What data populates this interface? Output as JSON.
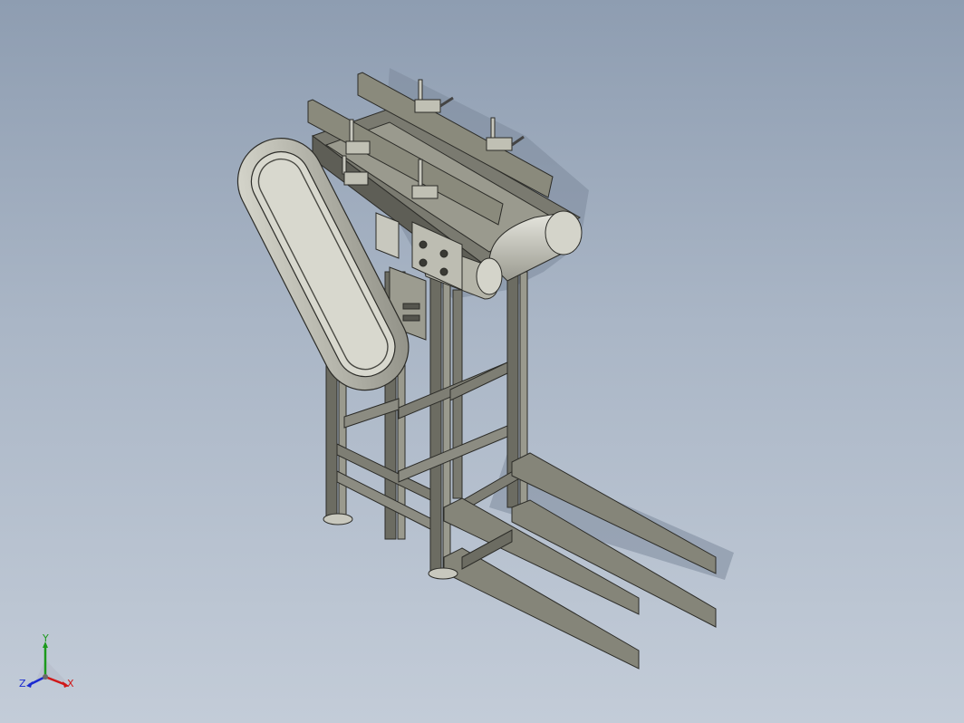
{
  "triad": {
    "x_label": "X",
    "y_label": "Y",
    "z_label": "Z",
    "x_color": "#d01818",
    "y_color": "#1c9a1c",
    "z_color": "#1a2ad0"
  }
}
